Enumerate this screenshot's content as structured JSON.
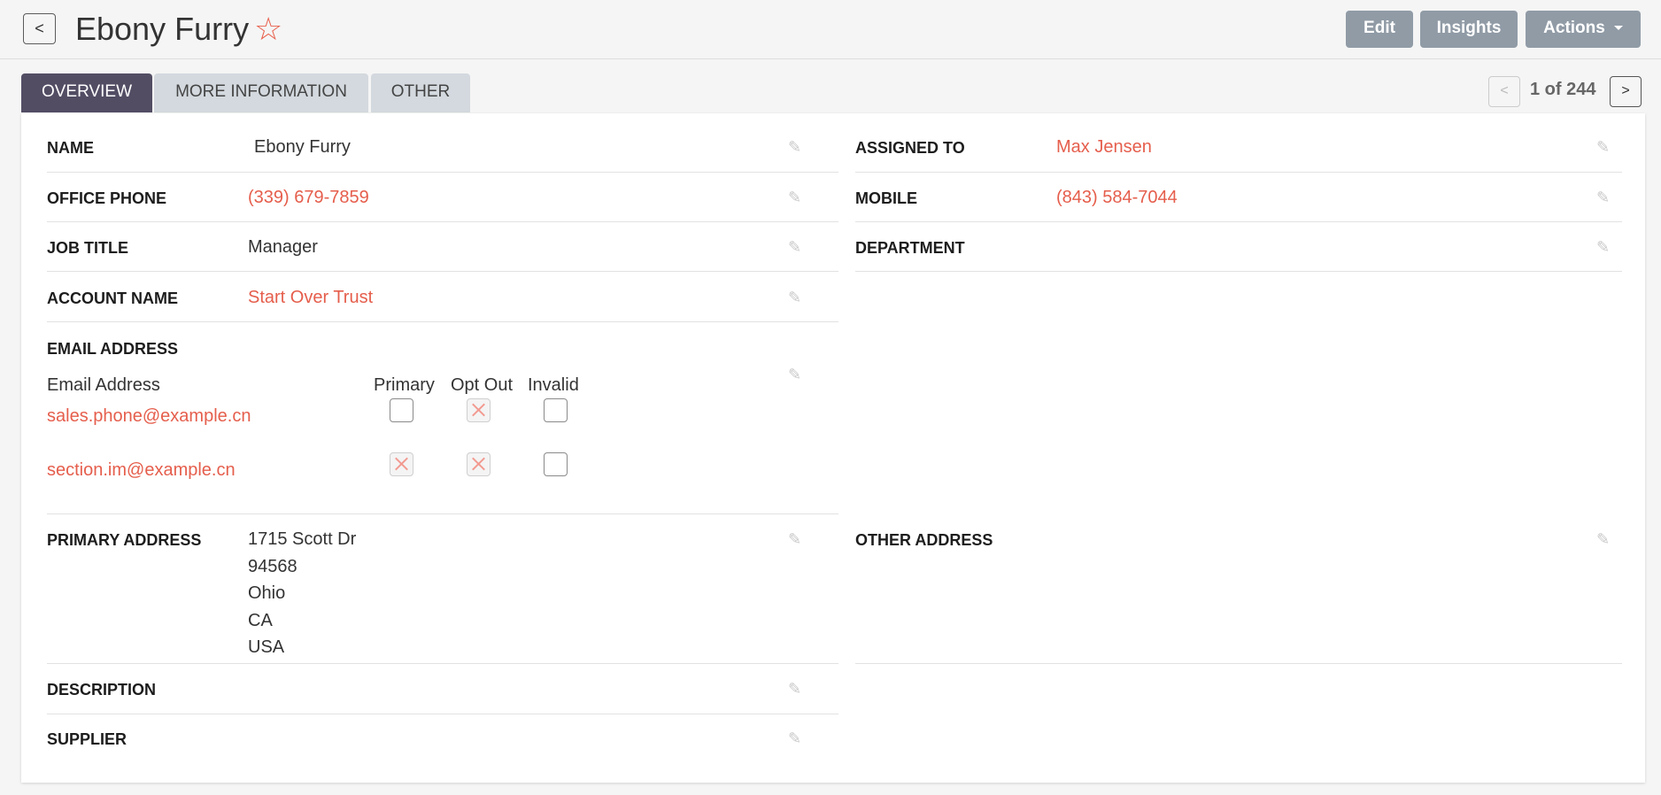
{
  "header": {
    "back_label": "<",
    "title": "Ebony Furry",
    "favorite_icon": "star-outline-icon",
    "buttons": {
      "edit": "Edit",
      "insights": "Insights",
      "actions": "Actions"
    }
  },
  "tabs": [
    {
      "label": "OVERVIEW",
      "active": true
    },
    {
      "label": "MORE INFORMATION",
      "active": false
    },
    {
      "label": "OTHER",
      "active": false
    }
  ],
  "pager": {
    "prev": "<",
    "text": "1 of 244",
    "next": ">"
  },
  "fields": {
    "name": {
      "label": "NAME",
      "value": "Ebony Furry"
    },
    "assigned_to": {
      "label": "ASSIGNED TO",
      "value": "Max Jensen"
    },
    "office_phone": {
      "label": "OFFICE PHONE",
      "value": "(339) 679-7859"
    },
    "mobile": {
      "label": "MOBILE",
      "value": "(843) 584-7044"
    },
    "job_title": {
      "label": "JOB TITLE",
      "value": "Manager"
    },
    "department": {
      "label": "DEPARTMENT",
      "value": ""
    },
    "account_name": {
      "label": "ACCOUNT NAME",
      "value": "Start Over Trust"
    },
    "email_address": {
      "label": "EMAIL ADDRESS"
    },
    "primary_address": {
      "label": "PRIMARY ADDRESS",
      "lines": [
        "1715 Scott Dr",
        "94568",
        "Ohio",
        "CA",
        "USA"
      ]
    },
    "other_address": {
      "label": "OTHER ADDRESS"
    },
    "description": {
      "label": "DESCRIPTION"
    },
    "supplier": {
      "label": "SUPPLIER"
    }
  },
  "email_table": {
    "headers": {
      "address": "Email Address",
      "primary": "Primary",
      "opt_out": "Opt Out",
      "invalid": "Invalid"
    },
    "rows": [
      {
        "address": "sales.phone@example.cn",
        "primary": false,
        "opt_out": true,
        "invalid": false
      },
      {
        "address": "section.im@example.cn",
        "primary": true,
        "opt_out": true,
        "invalid": false
      }
    ]
  },
  "colors": {
    "accent": "#e55e4c",
    "tab_active": "#534d64",
    "button": "#909ba6"
  }
}
